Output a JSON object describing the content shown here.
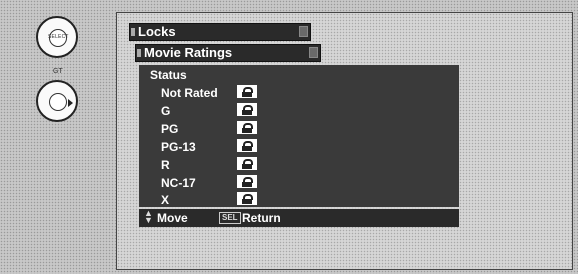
{
  "remote": {
    "select_label": "SELECT",
    "pad_label": "GT"
  },
  "menu": {
    "title": "Locks",
    "subtitle": "Movie Ratings",
    "status_label": "Status",
    "ratings": [
      {
        "label": "Not Rated",
        "icon": "lock-icon"
      },
      {
        "label": "G",
        "icon": "lock-icon"
      },
      {
        "label": "PG",
        "icon": "lock-icon"
      },
      {
        "label": "PG-13",
        "icon": "lock-icon"
      },
      {
        "label": "R",
        "icon": "lock-icon"
      },
      {
        "label": "NC-17",
        "icon": "lock-icon"
      },
      {
        "label": "X",
        "icon": "lock-icon"
      }
    ]
  },
  "footer": {
    "move_label": "Move",
    "sel_key": "SEL",
    "return_label": "Return"
  }
}
